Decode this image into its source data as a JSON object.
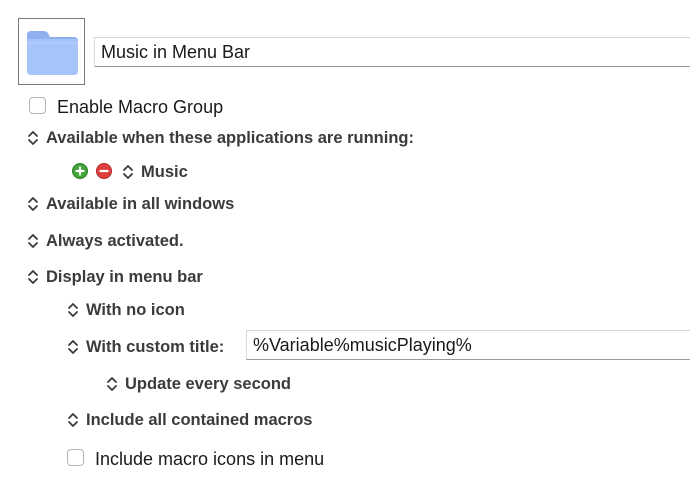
{
  "group": {
    "icon": "folder-icon",
    "name": "Music in Menu Bar",
    "enable_label": "Enable Macro Group"
  },
  "availability": {
    "applications_popup": "Available when these applications are running:",
    "add_icon": "plus-circle-icon",
    "remove_icon": "minus-circle-icon",
    "application": "Music",
    "windows_popup": "Available in all windows",
    "activation_popup": "Always activated."
  },
  "menu_bar": {
    "display_popup": "Display in menu bar",
    "icon_popup": "With no icon",
    "title_popup": "With custom title:",
    "title_value": "%Variable%musicPlaying%",
    "update_popup": "Update every second",
    "macros_popup": "Include all contained macros",
    "icons_checkbox_label": "Include macro icons in menu"
  },
  "colors": {
    "text": "#3b3b3b",
    "folder_blue": "#9cbcf8",
    "add_green": "#43a43a",
    "remove_red": "#dd3f3f"
  }
}
